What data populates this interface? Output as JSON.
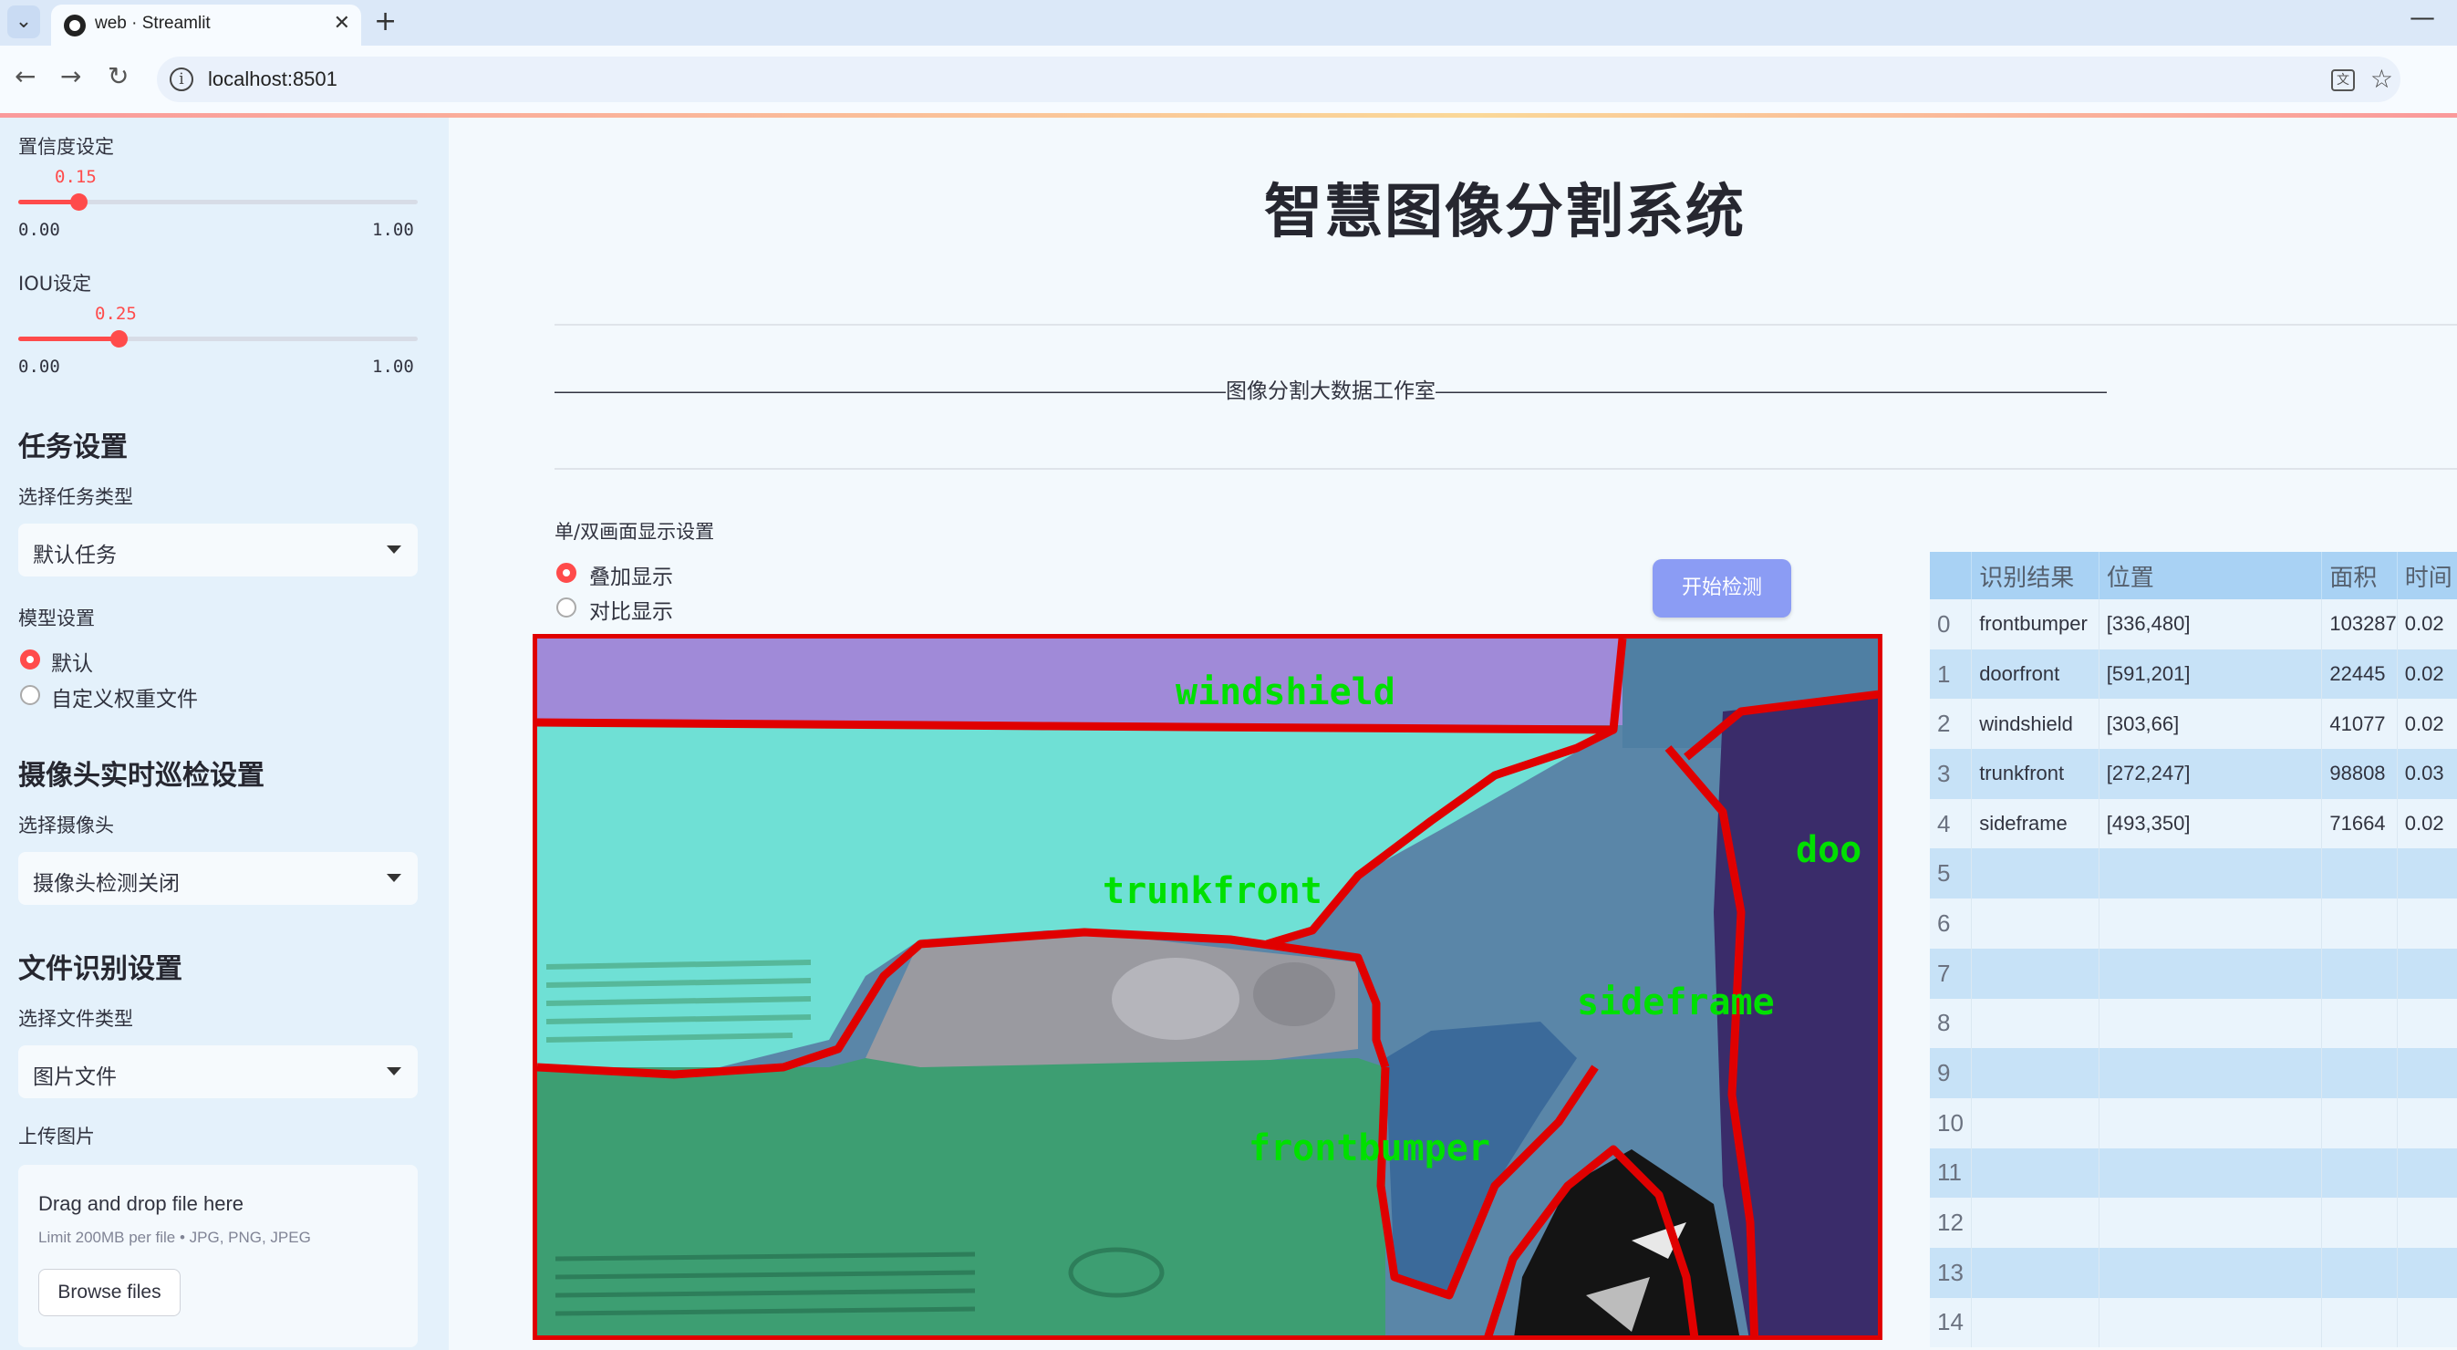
{
  "browser": {
    "tab_title": "web · Streamlit",
    "url": "localhost:8501"
  },
  "sidebar": {
    "confidence": {
      "label": "置信度设定",
      "value": "0.15",
      "min": "0.00",
      "max": "1.00",
      "fraction": 0.15
    },
    "iou": {
      "label": "IOU设定",
      "value": "0.25",
      "min": "0.00",
      "max": "1.00",
      "fraction": 0.25
    },
    "task": {
      "heading": "任务设置",
      "select_label": "选择任务类型",
      "selected": "默认任务"
    },
    "model": {
      "label": "模型设置",
      "options": [
        "默认",
        "自定义权重文件"
      ],
      "selected_index": 0
    },
    "camera": {
      "heading": "摄像头实时巡检设置",
      "select_label": "选择摄像头",
      "selected": "摄像头检测关闭"
    },
    "file": {
      "heading": "文件识别设置",
      "select_label": "选择文件类型",
      "selected": "图片文件",
      "upload_label": "上传图片"
    },
    "uploader": {
      "title": "Drag and drop file here",
      "subtitle": "Limit 200MB per file • JPG, PNG, JPEG",
      "button": "Browse files"
    }
  },
  "main": {
    "title": "智慧图像分割系统",
    "divider_text": "————————————————————————————————图像分割大数据工作室————————————————————————————————",
    "display_mode": {
      "label": "单/双画面显示设置",
      "options": [
        "叠加显示",
        "对比显示"
      ],
      "selected_index": 0
    },
    "start_button": "开始检测",
    "image_labels": [
      "windshield",
      "trunkfront",
      "doo",
      "sideframe",
      "frontbumper"
    ]
  },
  "results_table": {
    "columns": [
      "",
      "识别结果",
      "位置",
      "面积",
      "时间"
    ],
    "rows": [
      {
        "idx": "0",
        "result": "frontbumper",
        "position": "[336,480]",
        "area": "103287",
        "time": "0.02"
      },
      {
        "idx": "1",
        "result": "doorfront",
        "position": "[591,201]",
        "area": "22445",
        "time": "0.02"
      },
      {
        "idx": "2",
        "result": "windshield",
        "position": "[303,66]",
        "area": "41077",
        "time": "0.02"
      },
      {
        "idx": "3",
        "result": "trunkfront",
        "position": "[272,247]",
        "area": "98808",
        "time": "0.03"
      },
      {
        "idx": "4",
        "result": "sideframe",
        "position": "[493,350]",
        "area": "71664",
        "time": "0.02"
      },
      {
        "idx": "5",
        "result": "",
        "position": "",
        "area": "",
        "time": ""
      },
      {
        "idx": "6",
        "result": "",
        "position": "",
        "area": "",
        "time": ""
      },
      {
        "idx": "7",
        "result": "",
        "position": "",
        "area": "",
        "time": ""
      },
      {
        "idx": "8",
        "result": "",
        "position": "",
        "area": "",
        "time": ""
      },
      {
        "idx": "9",
        "result": "",
        "position": "",
        "area": "",
        "time": ""
      },
      {
        "idx": "10",
        "result": "",
        "position": "",
        "area": "",
        "time": ""
      },
      {
        "idx": "11",
        "result": "",
        "position": "",
        "area": "",
        "time": ""
      },
      {
        "idx": "12",
        "result": "",
        "position": "",
        "area": "",
        "time": ""
      },
      {
        "idx": "13",
        "result": "",
        "position": "",
        "area": "",
        "time": ""
      },
      {
        "idx": "14",
        "result": "",
        "position": "",
        "area": "",
        "time": ""
      }
    ]
  },
  "colors": {
    "accent": "#ff4b4b",
    "button": "#8b9cf4",
    "mask_outline": "#e00000",
    "label_text": "#00e000"
  }
}
